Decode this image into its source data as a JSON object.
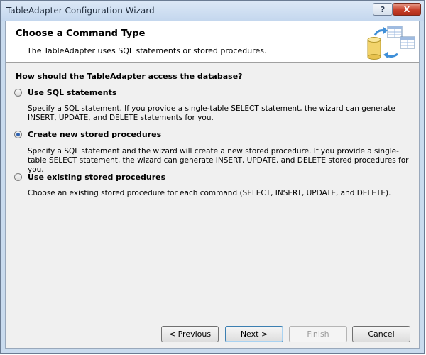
{
  "window": {
    "title": "TableAdapter Configuration Wizard",
    "help_label": "?",
    "close_label": "X"
  },
  "header": {
    "title": "Choose a Command Type",
    "subtitle": "The TableAdapter uses SQL statements or stored procedures."
  },
  "question": "How should the TableAdapter access the database?",
  "options": [
    {
      "label": "Use SQL statements",
      "checked": false,
      "description": "Specify a SQL statement. If you provide a single-table SELECT statement, the wizard can generate INSERT, UPDATE, and DELETE statements for you."
    },
    {
      "label": "Create new stored procedures",
      "checked": true,
      "description": "Specify a SQL statement and the wizard will create a new stored procedure. If you provide a single-table SELECT statement, the wizard can generate INSERT, UPDATE, and DELETE stored procedures for you."
    },
    {
      "label": "Use existing stored procedures",
      "checked": false,
      "description": "Choose an existing stored procedure for each command (SELECT, INSERT, UPDATE, and DELETE)."
    }
  ],
  "buttons": {
    "previous": "< Previous",
    "next": "Next >",
    "finish": "Finish",
    "cancel": "Cancel"
  },
  "colors": {
    "title_bar": "#c9dbee",
    "close_button": "#c7402a",
    "selected_radio": "#2f62b0"
  }
}
